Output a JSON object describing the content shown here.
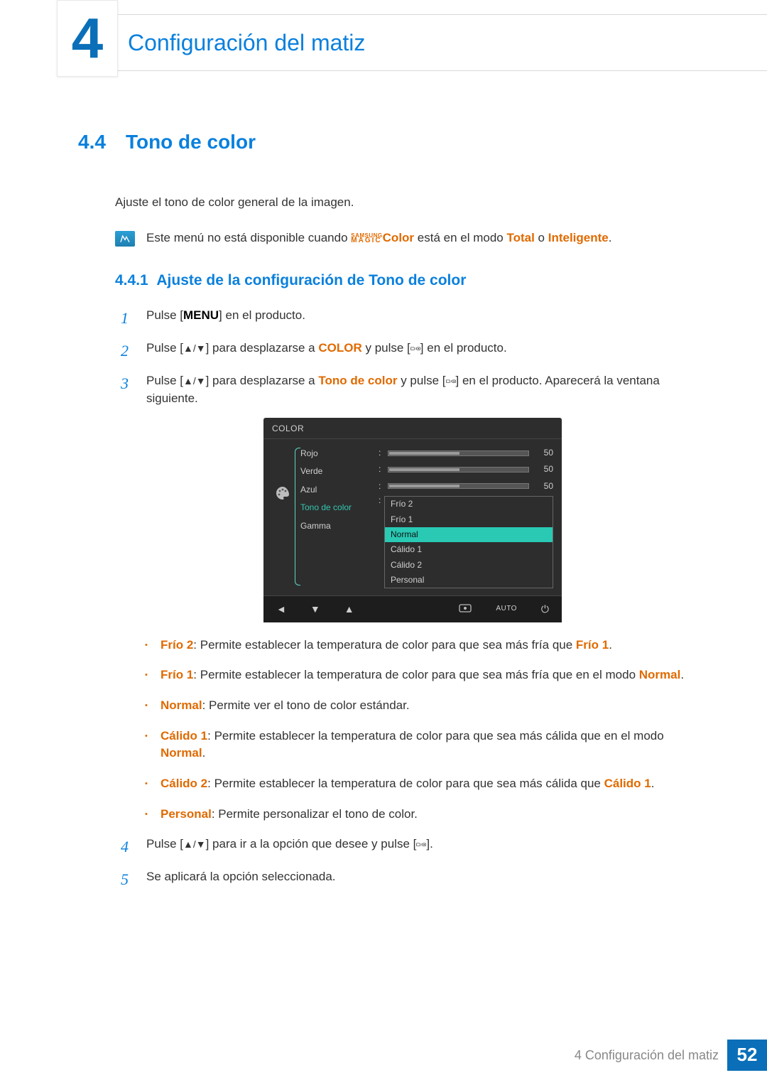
{
  "chapter": {
    "number": "4",
    "title": "Configuración del matiz"
  },
  "section": {
    "number": "4.4",
    "title": "Tono de color"
  },
  "intro": "Ajuste el tono de color general de la imagen.",
  "note": {
    "pre": "Este menú no está disponible cuando ",
    "magic_sup": "SAMSUNG",
    "magic_sub": "MAGIC",
    "magic_tail": "Color",
    "mid": " está en el modo ",
    "mode1": "Total",
    "or": " o ",
    "mode2": "Inteligente",
    "end": "."
  },
  "subsection": {
    "number": "4.4.1",
    "title": "Ajuste de la configuración de Tono de color"
  },
  "steps": {
    "s1": {
      "n": "1",
      "a": "Pulse [",
      "menu": "MENU",
      "b": "] en el producto."
    },
    "s2": {
      "n": "2",
      "a": "Pulse [",
      "b": "] para desplazarse a ",
      "target": "COLOR",
      "c": " y pulse [",
      "d": "] en el producto."
    },
    "s3": {
      "n": "3",
      "a": "Pulse [",
      "b": "] para desplazarse a ",
      "target": "Tono de color",
      "c": " y pulse [",
      "d": "] en el producto. Aparecerá la ventana siguiente."
    },
    "s4": {
      "n": "4",
      "a": "Pulse [",
      "b": "] para ir a la opción que desee y pulse [",
      "c": "]."
    },
    "s5": {
      "n": "5",
      "a": "Se aplicará la opción seleccionada."
    }
  },
  "osd": {
    "title": "COLOR",
    "rows": {
      "rojo": {
        "label": "Rojo",
        "value": "50"
      },
      "verde": {
        "label": "Verde",
        "value": "50"
      },
      "azul": {
        "label": "Azul",
        "value": "50"
      },
      "tono": {
        "label": "Tono de color"
      },
      "gamma": {
        "label": "Gamma"
      }
    },
    "options": [
      "Frío 2",
      "Frío 1",
      "Normal",
      "Cálido 1",
      "Cálido 2",
      "Personal"
    ],
    "selected_index": 2,
    "footer_auto": "AUTO"
  },
  "bullets": {
    "b1": {
      "term": "Frío 2",
      "text": ": Permite establecer la temperatura de color para que sea más fría que ",
      "ref": "Frío 1",
      "end": "."
    },
    "b2": {
      "term": "Frío 1",
      "text": ": Permite establecer la temperatura de color para que sea más fría que en el modo ",
      "ref": "Normal",
      "end": "."
    },
    "b3": {
      "term": "Normal",
      "text": ": Permite ver el tono de color estándar."
    },
    "b4": {
      "term": "Cálido 1",
      "text": ": Permite establecer la temperatura de color para que sea más cálida que en el modo ",
      "ref": "Normal",
      "end": "."
    },
    "b5": {
      "term": "Cálido 2",
      "text": ": Permite establecer la temperatura de color para que sea más cálida que ",
      "ref": "Cálido 1",
      "end": "."
    },
    "b6": {
      "term": "Personal",
      "text": ": Permite personalizar el tono de color."
    }
  },
  "footer": {
    "label": "4 Configuración del matiz",
    "page": "52"
  }
}
